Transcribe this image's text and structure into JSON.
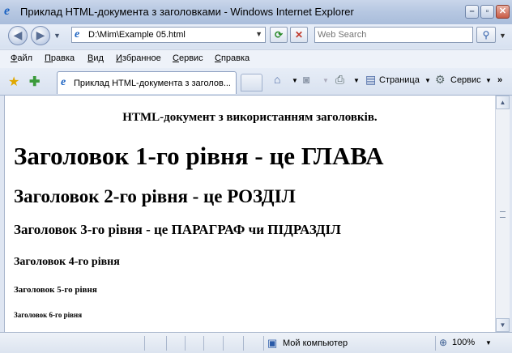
{
  "window": {
    "title": "Приклад HTML-документа з заголовками - Windows Internet Explorer",
    "buttons": {
      "minimize": "–",
      "maximize": "▫",
      "close": "✕"
    }
  },
  "nav": {
    "back": "◀",
    "forward": "▶",
    "address": "D:\\Mim\\Example 05.html",
    "refresh": "⟳",
    "stop": "✕",
    "search_placeholder": "Web Search",
    "search_button": "⚲"
  },
  "menu": [
    {
      "underlined": "Ф",
      "rest": "айл"
    },
    {
      "underlined": "П",
      "rest": "равка"
    },
    {
      "underlined": "В",
      "rest": "ид"
    },
    {
      "underlined": "И",
      "rest": "збранное"
    },
    {
      "underlined": "С",
      "rest": "ервис"
    },
    {
      "underlined": "С",
      "rest": "правка"
    }
  ],
  "tabs": {
    "active": "Приклад HTML-документа з заголов..."
  },
  "commands": {
    "page": "Страница",
    "tools": "Сервис",
    "more": "»"
  },
  "content": {
    "intro": "HTML-документ з використанням заголовків.",
    "h1": "Заголовок 1-го рівня - це ГЛАВА",
    "h2": "Заголовок 2-го рівня - це РОЗДІЛ",
    "h3": "Заголовок 3-го рівня - це ПАРАГРАФ чи ПІДРАЗДІЛ",
    "h4": "Заголовок 4-го рівня",
    "h5": "Заголовок 5-го рівня",
    "h6": "Заголовок 6-го рівня"
  },
  "status": {
    "zone": "Мой компьютер",
    "zoom": "100%"
  },
  "colors": {
    "accent": "#1a62c2",
    "frame": "#dfe6f2"
  }
}
